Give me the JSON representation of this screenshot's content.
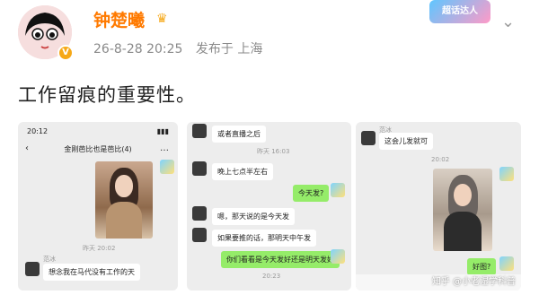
{
  "post": {
    "username": "钟楚曦",
    "date": "26-8-28 20:25",
    "published_in": "发布于 上海",
    "text": "工作留痕的重要性。",
    "promo_label": "超话达人"
  },
  "screenshot1": {
    "time": "20:12",
    "chat_title": "金刚芭比也是芭比(4)",
    "timestamp": "昨天 20:02",
    "sender_name": "范冰",
    "last_message": "想念我在马代没有工作的天"
  },
  "screenshot2": {
    "messages": [
      {
        "text": "或者直播之后",
        "me": false
      },
      {
        "text": "晚上七点半左右",
        "me": false
      },
      {
        "text": "今天发?",
        "me": true
      },
      {
        "text": "嗯，那天说的是今天发",
        "me": false
      },
      {
        "text": "如果要推的话，那明天中午发",
        "me": false
      },
      {
        "text": "你们看看是今天发好还是明天发好",
        "me": true
      }
    ],
    "timestamps": [
      "昨天 16:03",
      "20:23"
    ]
  },
  "screenshot3": {
    "sender_name": "范冰",
    "messages": [
      {
        "text": "这会儿发就可",
        "me": false
      },
      {
        "text": "好图?",
        "me": true
      }
    ],
    "timestamp": "20:02"
  },
  "watermark": "知乎 @小老湿学科普",
  "colors": {
    "username": "#ff7a00",
    "me_bubble": "#95ec69",
    "panel_bg": "#ededed"
  }
}
